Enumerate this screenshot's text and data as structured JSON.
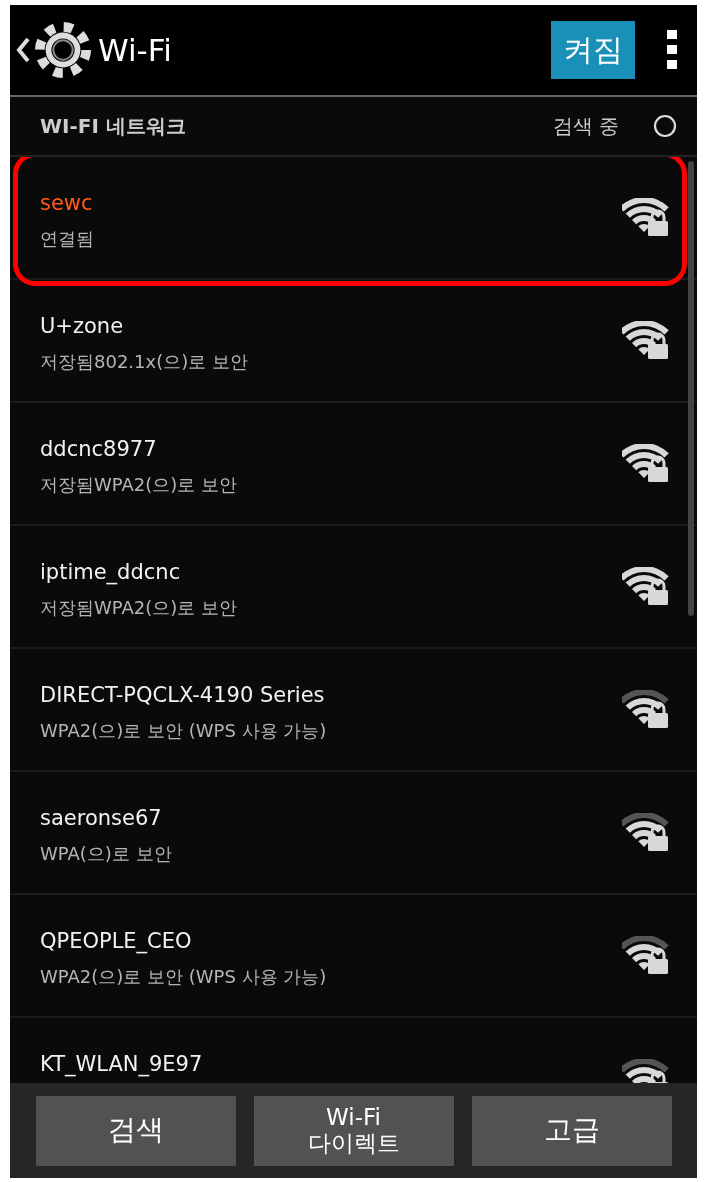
{
  "header": {
    "title": "Wi-Fi",
    "switch": {
      "label": "켜짐",
      "on": true
    }
  },
  "section": {
    "title": "WI-FI 네트워크",
    "status": "검색 중"
  },
  "networks": [
    {
      "name": "sewc",
      "detail": "연결됨",
      "connected": true,
      "highlighted": true,
      "full_signal": true,
      "secured": true
    },
    {
      "name": "U+zone",
      "detail": "저장됨802.1x(으)로 보안",
      "connected": false,
      "highlighted": false,
      "full_signal": true,
      "secured": true
    },
    {
      "name": "ddcnc8977",
      "detail": "저장됨WPA2(으)로 보안",
      "connected": false,
      "highlighted": false,
      "full_signal": true,
      "secured": true
    },
    {
      "name": "iptime_ddcnc",
      "detail": "저장됨WPA2(으)로 보안",
      "connected": false,
      "highlighted": false,
      "full_signal": true,
      "secured": true
    },
    {
      "name": "DIRECT-PQCLX-4190 Series",
      "detail": "WPA2(으)로 보안 (WPS 사용 가능)",
      "connected": false,
      "highlighted": false,
      "full_signal": false,
      "secured": true
    },
    {
      "name": "saeronse67",
      "detail": "WPA(으)로 보안",
      "connected": false,
      "highlighted": false,
      "full_signal": false,
      "secured": true
    },
    {
      "name": "QPEOPLE_CEO",
      "detail": "WPA2(으)로 보안 (WPS 사용 가능)",
      "connected": false,
      "highlighted": false,
      "full_signal": false,
      "secured": true
    },
    {
      "name": "KT_WLAN_9E97",
      "connected": false,
      "highlighted": false,
      "full_signal": false,
      "secured": true
    }
  ],
  "buttons": [
    {
      "label": "검색"
    },
    {
      "label": "Wi-Fi\n다이렉트"
    },
    {
      "label": "고급"
    }
  ]
}
